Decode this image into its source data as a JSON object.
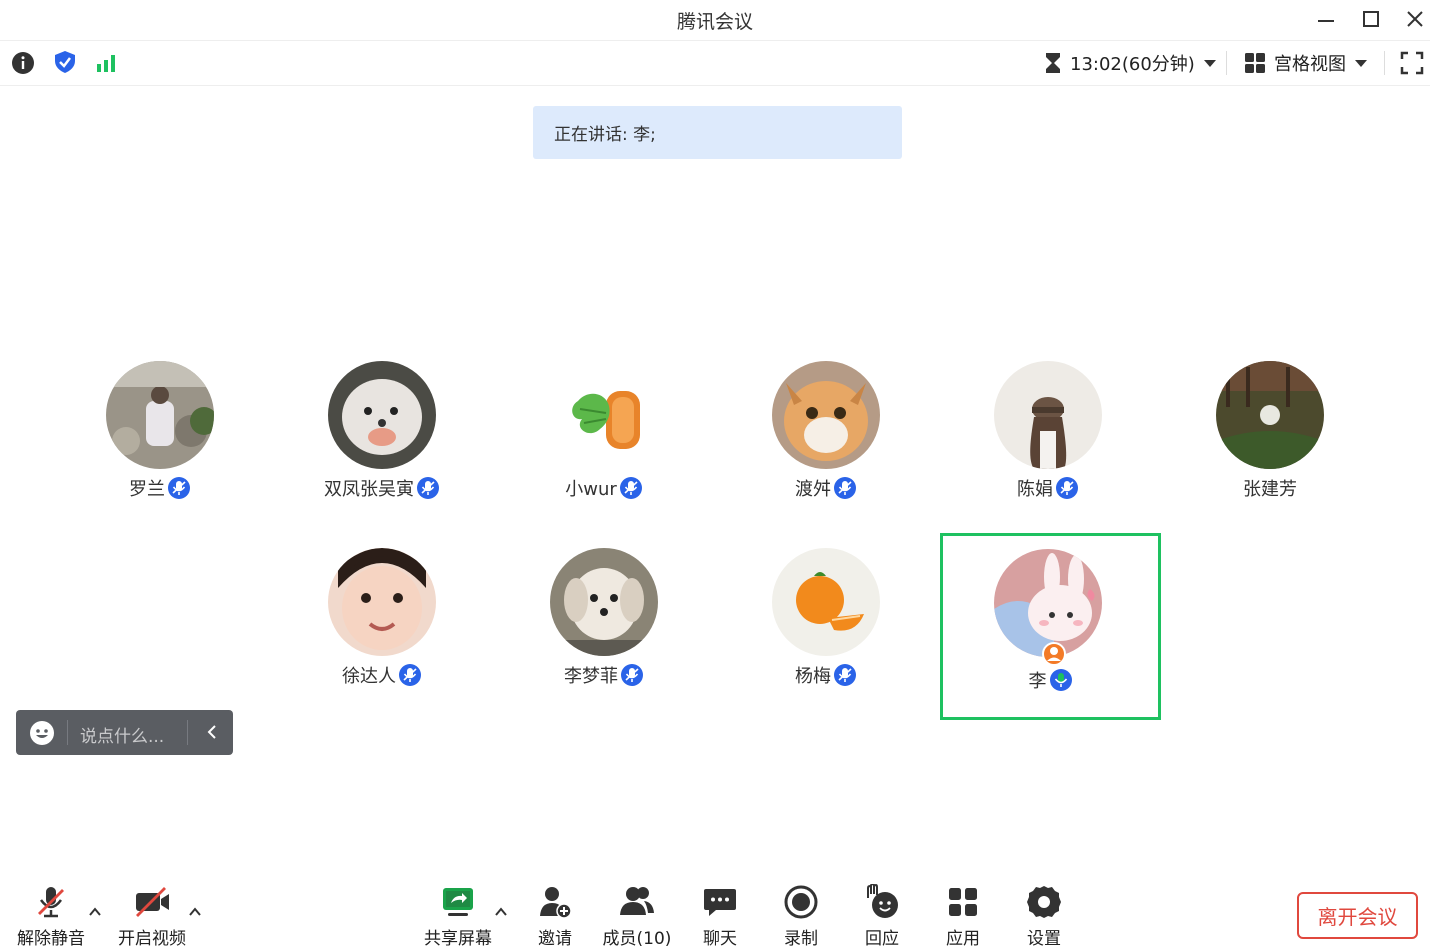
{
  "window": {
    "title": "腾讯会议"
  },
  "toolbar": {
    "timer": "13:02(60分钟)",
    "view_mode": "宫格视图"
  },
  "speaking": "正在讲话: 李;",
  "participants": [
    {
      "name": "罗兰",
      "mic": "muted"
    },
    {
      "name": "双凤张吴寅",
      "mic": "muted"
    },
    {
      "name": "小wur",
      "mic": "muted"
    },
    {
      "name": "渡舛",
      "mic": "muted"
    },
    {
      "name": "陈娟",
      "mic": "muted"
    },
    {
      "name": "张建芳",
      "mic": "none"
    },
    {
      "name": "徐达人",
      "mic": "muted"
    },
    {
      "name": "李梦菲",
      "mic": "muted"
    },
    {
      "name": "杨梅",
      "mic": "muted"
    },
    {
      "name": "李",
      "mic": "speaking",
      "host": true
    }
  ],
  "chat": {
    "placeholder": "说点什么..."
  },
  "bottom": {
    "unmute": "解除静音",
    "video": "开启视频",
    "share": "共享屏幕",
    "invite": "邀请",
    "members": "成员(10)",
    "chat": "聊天",
    "record": "录制",
    "react": "回应",
    "apps": "应用",
    "settings": "设置",
    "leave": "离开会议"
  },
  "colors": {
    "accent": "#2a63e8",
    "active_border": "#1ec160",
    "leave": "#e0483e",
    "share": "#1aa34a"
  }
}
